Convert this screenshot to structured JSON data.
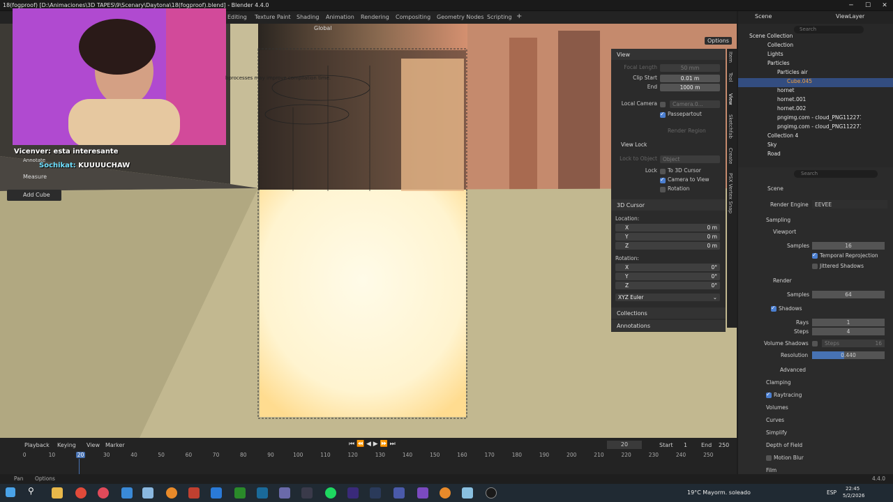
{
  "window": {
    "title": "18(fogproof) [D:\\Animaciones\\3D TAPES\\9\\Scenary\\Daytona\\18(fogproof).blend] - Blender 4.4.0"
  },
  "workspaces": [
    "Editing",
    "Texture Paint",
    "Shading",
    "Animation",
    "Rendering",
    "Compositing",
    "Geometry Nodes",
    "Scripting"
  ],
  "header": {
    "scene_label": "Scene",
    "viewlayer_label": "ViewLayer",
    "transform_orientation": "Global",
    "options_label": "Options"
  },
  "toolbar": {
    "annotate": "Annotate",
    "measure": "Measure",
    "add_cube": "Add Cube"
  },
  "viewport": {
    "info_text": "bprocesses may improve compilation time."
  },
  "chat": [
    {
      "user": "Vicenver:",
      "msg": "esta interesante"
    },
    {
      "user": "Sochikat:",
      "msg": "KUUUUCHAW"
    }
  ],
  "npanel": {
    "view_title": "View",
    "focal_length_label": "Focal Length",
    "focal_length_value": "50 mm",
    "clip_start_label": "Clip Start",
    "clip_start_value": "0.01 m",
    "end_label": "End",
    "end_value": "1000 m",
    "local_camera_label": "Local Camera",
    "local_camera_value": "Camera.0...",
    "passepartout_label": "Passepartout",
    "render_region_label": "Render Region",
    "view_lock_title": "View Lock",
    "lock_to_object_label": "Lock to Object",
    "lock_to_object_value": "Object",
    "lock_label": "Lock",
    "to_3d_cursor": "To 3D Cursor",
    "camera_to_view": "Camera to View",
    "rotation_label": "Rotation",
    "cursor_title": "3D Cursor",
    "location_label": "Location:",
    "x": "X",
    "y": "Y",
    "z": "Z",
    "loc_x": "0 m",
    "loc_y": "0 m",
    "loc_z": "0 m",
    "rotation_title": "Rotation:",
    "rot_x": "0°",
    "rot_y": "0°",
    "rot_z": "0°",
    "euler": "XYZ Euler",
    "collections": "Collections",
    "annotations": "Annotations"
  },
  "side_tabs": [
    "Item",
    "Tool",
    "View",
    "Sketchfab",
    "Create",
    "PSX Vertex Snap"
  ],
  "outliner": {
    "search_placeholder": "Search",
    "items": [
      {
        "name": "Scene Collection"
      },
      {
        "name": "Collection"
      },
      {
        "name": "Lights"
      },
      {
        "name": "Particles"
      },
      {
        "name": "Particles air"
      },
      {
        "name": "Cube.045"
      },
      {
        "name": "hornet"
      },
      {
        "name": "hornet.001"
      },
      {
        "name": "hornet.002"
      },
      {
        "name": "pngimg.com - cloud_PNG112271"
      },
      {
        "name": "pngimg.com - cloud_PNG112271"
      },
      {
        "name": "Collection 4"
      },
      {
        "name": "Sky"
      },
      {
        "name": "Road"
      }
    ]
  },
  "properties": {
    "search_placeholder": "Search",
    "scene": "Scene",
    "render_engine_label": "Render Engine",
    "render_engine_value": "EEVEE",
    "sampling": "Sampling",
    "viewport": "Viewport",
    "samples_label": "Samples",
    "viewport_samples": "16",
    "temporal_reprojection": "Temporal Reprojection",
    "jittered_shadows": "Jittered Shadows",
    "render": "Render",
    "render_samples": "64",
    "shadows": "Shadows",
    "rays_label": "Rays",
    "rays_value": "1",
    "steps_label": "Steps",
    "steps_value": "4",
    "volume_shadows": "Volume Shadows",
    "vol_steps_label": "Steps",
    "vol_steps_value": "16",
    "resolution_label": "Resolution",
    "resolution_value": "0.440",
    "resolution_fraction": 0.44,
    "advanced": "Advanced",
    "clamping": "Clamping",
    "raytracing": "Raytracing",
    "volumes": "Volumes",
    "curves": "Curves",
    "simplify": "Simplify",
    "depth_of_field": "Depth of Field",
    "motion_blur": "Motion Blur",
    "film": "Film"
  },
  "timeline": {
    "playback": "Playback",
    "keying": "Keying",
    "view": "View",
    "marker": "Marker",
    "current_frame": "20",
    "start_label": "Start",
    "start_value": "1",
    "end_label": "End",
    "end_value": "250",
    "ticks": [
      "0",
      "10",
      "20",
      "30",
      "40",
      "50",
      "60",
      "70",
      "80",
      "90",
      "100",
      "110",
      "120",
      "130",
      "140",
      "150",
      "160",
      "170",
      "180",
      "190",
      "200",
      "210",
      "220",
      "230",
      "240",
      "250"
    ]
  },
  "status": {
    "pan": "Pan",
    "options": "Options",
    "version": "4.4.0"
  },
  "taskbar": {
    "weather": "19°C  Mayorm. soleado",
    "lang": "ESP",
    "time": "22:45",
    "date": "5/2/2026"
  }
}
